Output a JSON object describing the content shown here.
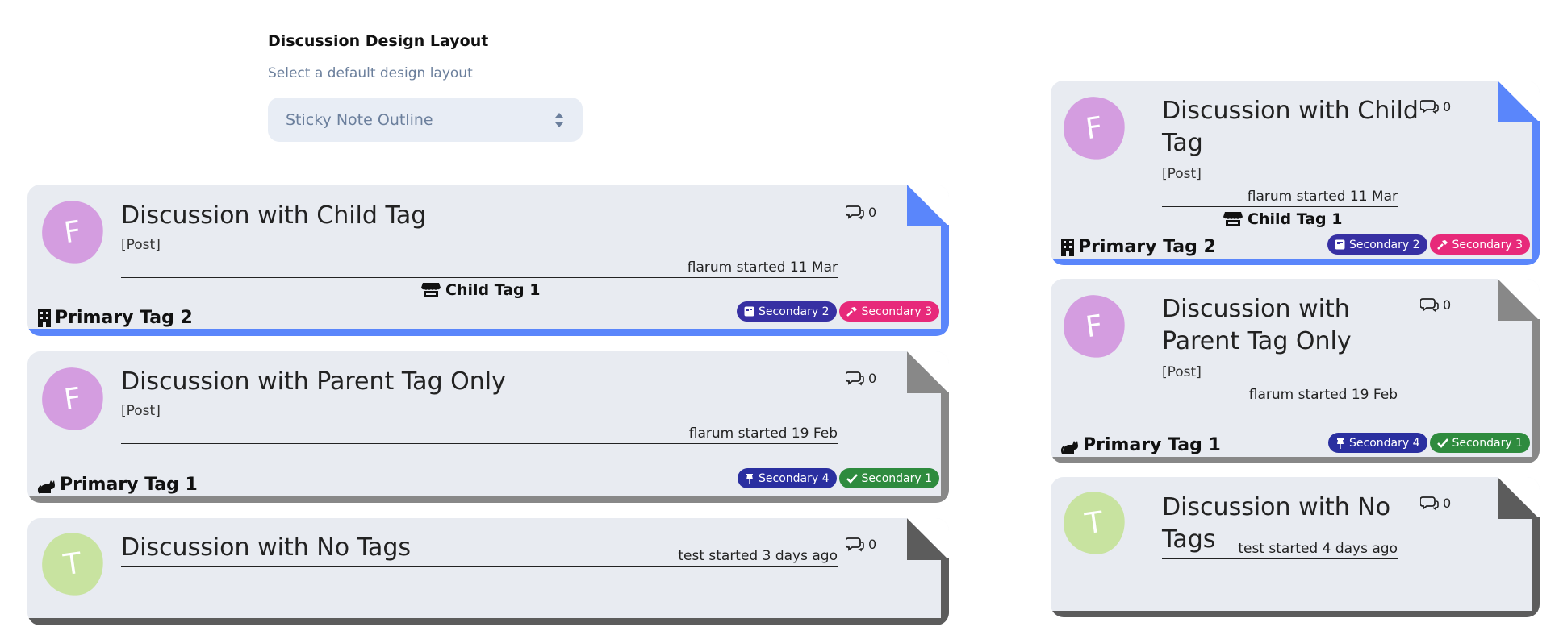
{
  "settings": {
    "title": "Discussion Design Layout",
    "help": "Select a default design layout",
    "selected": "Sticky Note Outline"
  },
  "colors": {
    "card_bg": "#e8ebf1",
    "blue_border": "#5a86fb",
    "gray_border": "#888888",
    "dark_border": "#5c5c5c",
    "avatar_f": "#d49de0",
    "avatar_t": "#c8e3a0",
    "secondary_2": "#3730a3",
    "secondary_3": "#e7297a",
    "secondary_4": "#2a2fa0",
    "secondary_1": "#2e8b3e"
  },
  "wide": {
    "child": {
      "avatar": "F",
      "title": "Discussion with Child Tag",
      "excerpt": "[Post]",
      "meta": "flarum started 11 Mar",
      "replies": "0",
      "child_tag": "Child Tag 1",
      "primary_tag": "Primary Tag 2",
      "badge_a": "Secondary 2",
      "badge_b": "Secondary 3"
    },
    "parent": {
      "avatar": "F",
      "title": "Discussion with Parent Tag Only",
      "excerpt": "[Post]",
      "meta": "flarum started 19 Feb",
      "replies": "0",
      "primary_tag": "Primary Tag 1",
      "badge_a": "Secondary 4",
      "badge_b": "Secondary 1"
    },
    "none": {
      "avatar": "T",
      "title": "Discussion with No Tags",
      "meta": "test started 3 days ago",
      "replies": "0"
    }
  },
  "narrow": {
    "child": {
      "avatar": "F",
      "title_line1": "Discussion with Child",
      "title_line2": "Tag",
      "excerpt": "[Post]",
      "meta": "flarum started 11 Mar",
      "replies": "0",
      "child_tag": "Child Tag 1",
      "primary_tag": "Primary Tag 2",
      "badge_a": "Secondary 2",
      "badge_b": "Secondary 3"
    },
    "parent": {
      "avatar": "F",
      "title_line1": "Discussion with",
      "title_line2": "Parent Tag Only",
      "excerpt": "[Post]",
      "meta": "flarum started 19 Feb",
      "replies": "0",
      "primary_tag": "Primary Tag 1",
      "badge_a": "Secondary 4",
      "badge_b": "Secondary 1"
    },
    "none": {
      "avatar": "T",
      "title_line1": "Discussion with No",
      "title_line2": "Tags",
      "meta": "test started 4 days ago",
      "replies": "0"
    }
  }
}
